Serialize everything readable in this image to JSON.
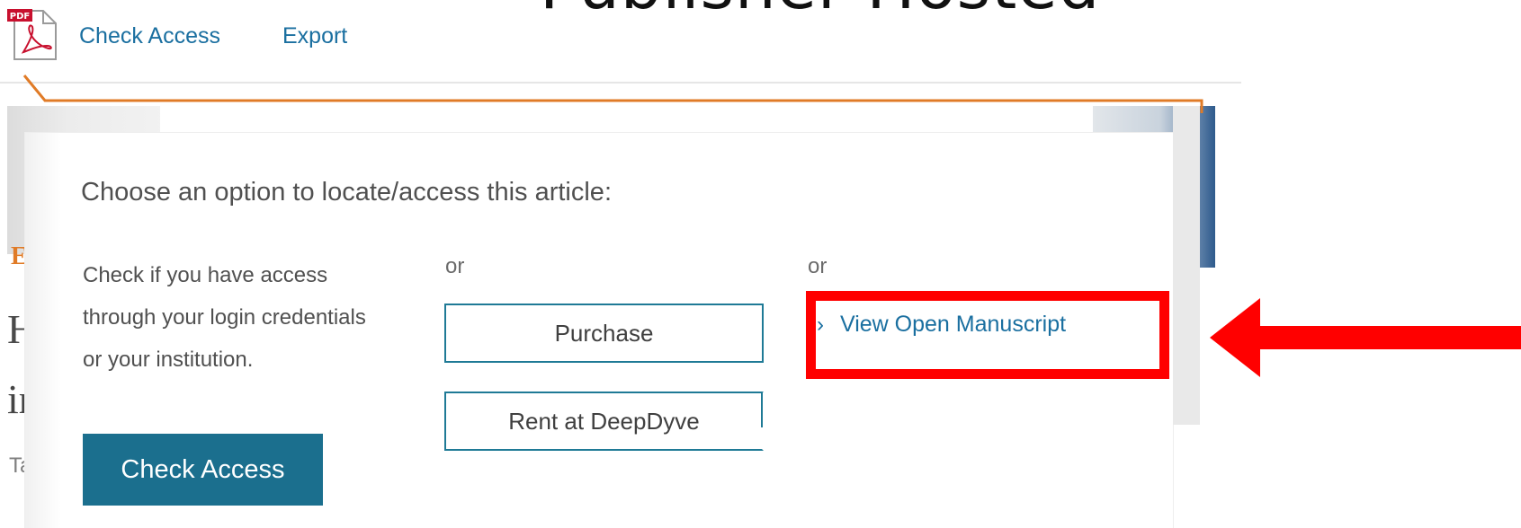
{
  "page": {
    "top_heading": "Publisher Hosted"
  },
  "toolbar": {
    "pdf_icon_label": "PDF",
    "check_access": "Check Access",
    "export": "Export"
  },
  "background": {
    "elsevier_fragment": "E",
    "title_fragment_1": "Hy",
    "title_fragment_2": "in",
    "author_fragment": "Tap"
  },
  "popover": {
    "title": "Choose an option to locate/access this article:",
    "description": "Check if you have access through your login credentials or your institution.",
    "or_1": "or",
    "or_2": "or",
    "purchase_label": "Purchase",
    "rent_label": "Rent at DeepDyve",
    "check_access_label": "Check Access",
    "open_manuscript_label": "View Open Manuscript"
  },
  "colors": {
    "link": "#1a6fa0",
    "button_fill": "#1b6f8e",
    "button_border": "#1f7a96",
    "popover_border": "#e07b27",
    "annotation": "#ff0000"
  },
  "icons": {
    "pdf": "pdf-file-icon",
    "chevron": "chevron-right-icon",
    "arrow": "arrow-left-icon"
  }
}
